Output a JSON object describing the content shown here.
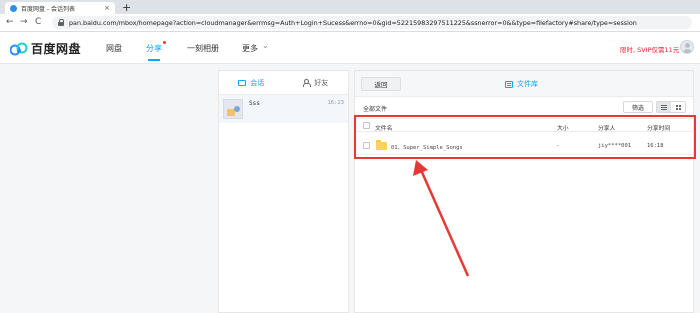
{
  "browser": {
    "tab_title": "百度网盘 - 会话列表",
    "tab_close": "×",
    "new_tab": "+",
    "back": "←",
    "forward": "→",
    "reload": "C",
    "url": "pan.baidu.com/mbox/homepage?action=cloudmanager&errmsg=Auth+Login+Sucess&errno=0&gid=52215983297511225&ssnerror=0&&type=filefactory#share/type=session"
  },
  "header": {
    "logo_text": "百度网盘",
    "nav": [
      "网盘",
      "分享",
      "一刻相册",
      "更多"
    ],
    "more_arrow": "⌄",
    "promo": "限时, SVIP仅需11元"
  },
  "left_panel": {
    "tabs": [
      "会话",
      "好友"
    ],
    "session": {
      "name": "Sss",
      "time": "16:23"
    }
  },
  "right_panel": {
    "back_button": "返回",
    "file_library": "文件库",
    "all_files": "全部文件",
    "filter_button": "筛选",
    "columns": [
      "文件名",
      "大小",
      "分享人",
      "分享时间"
    ],
    "rows": [
      {
        "name": "01、Super_Simple_Songs",
        "size": "-",
        "sharer": "jiy****001",
        "time": "16:18"
      }
    ]
  },
  "annotation": {
    "color": "#e53935"
  },
  "colors": {
    "accent": "#06a7ff",
    "promo": "#f5222d"
  }
}
